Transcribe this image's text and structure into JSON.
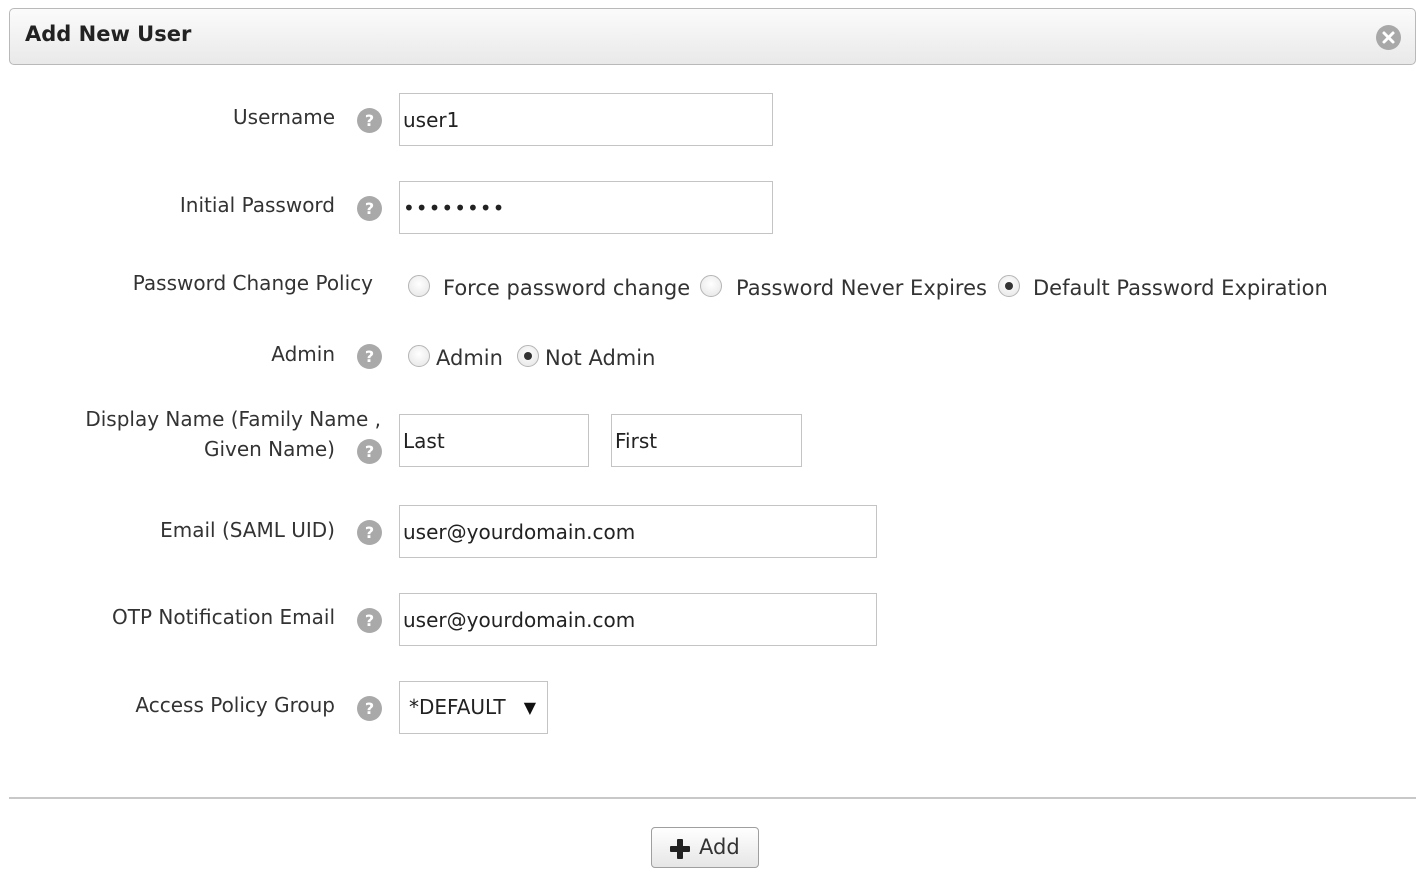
{
  "dialog": {
    "title": "Add New User",
    "close_icon": "close-icon"
  },
  "form": {
    "username": {
      "label": "Username",
      "value": "user1"
    },
    "initial_password": {
      "label": "Initial Password",
      "value": "••••••••"
    },
    "password_change_policy": {
      "label": "Password Change Policy",
      "options": [
        {
          "label": "Force password change",
          "selected": false
        },
        {
          "label": "Password Never Expires",
          "selected": false
        },
        {
          "label": "Default Password Expiration",
          "selected": true
        }
      ]
    },
    "admin": {
      "label": "Admin",
      "options": [
        {
          "label": "Admin",
          "selected": false
        },
        {
          "label": "Not Admin",
          "selected": true
        }
      ]
    },
    "display_name": {
      "label_line1": "Display Name (Family Name ,",
      "label_line2": "Given Name)",
      "family_value": "Last",
      "given_value": "First"
    },
    "email": {
      "label": "Email (SAML UID)",
      "value": "user@yourdomain.com"
    },
    "otp_email": {
      "label": "OTP Notification Email",
      "value": "user@yourdomain.com"
    },
    "access_policy_group": {
      "label": "Access Policy Group",
      "selected": "*DEFAULT"
    },
    "help_icon_glyph": "?"
  },
  "actions": {
    "add_label": "Add"
  }
}
